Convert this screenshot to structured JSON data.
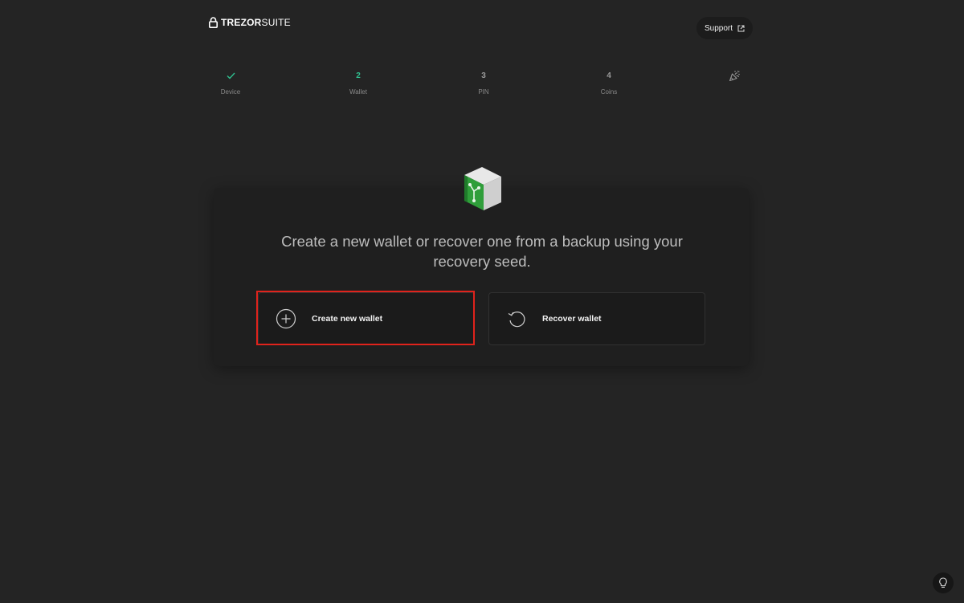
{
  "header": {
    "logo_strong": "TREZOR",
    "logo_light": "SUITE",
    "support_label": "Support"
  },
  "stepper": {
    "steps": [
      {
        "marker": "",
        "label": "Device",
        "state": "done"
      },
      {
        "marker": "2",
        "label": "Wallet",
        "state": "active"
      },
      {
        "marker": "3",
        "label": "PIN",
        "state": "pending"
      },
      {
        "marker": "4",
        "label": "Coins",
        "state": "pending"
      },
      {
        "marker": "",
        "label": "",
        "state": "final",
        "icon": "party-popper-icon"
      }
    ]
  },
  "card": {
    "title": "Create a new wallet or recover one from a backup using your recovery seed.",
    "options": [
      {
        "label": "Create new wallet",
        "icon": "plus-circle-icon"
      },
      {
        "label": "Recover wallet",
        "icon": "recover-arrow-icon"
      }
    ]
  },
  "colors": {
    "background": "#242424",
    "card": "#1f1f1f",
    "accent_green": "#2fbf8f",
    "highlight_red": "#e0231c"
  }
}
